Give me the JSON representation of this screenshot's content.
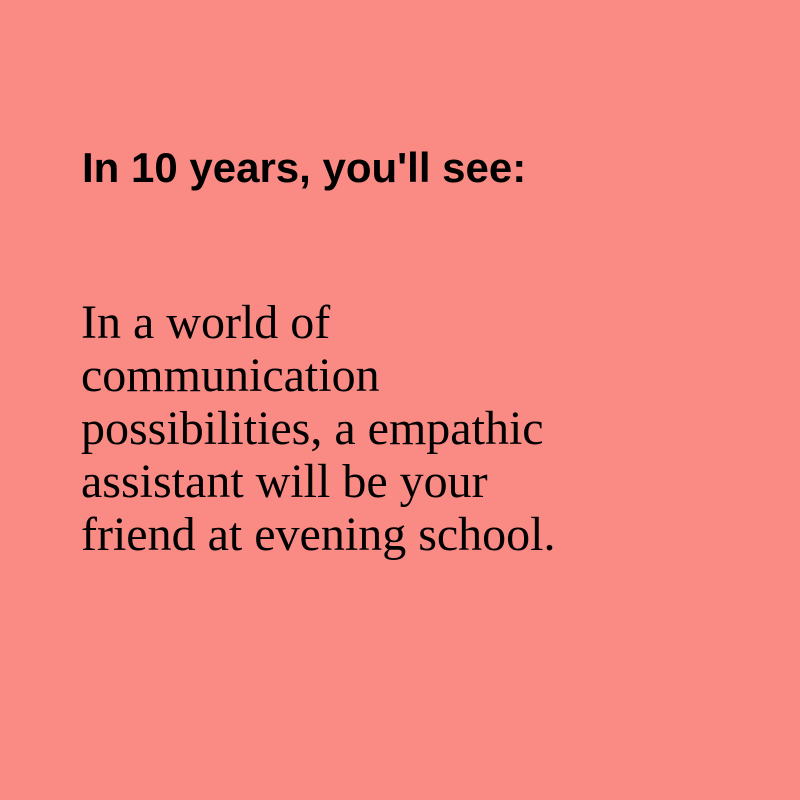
{
  "background_color": "#fa8a84",
  "text_color": "#000000",
  "heading": "In 10 years, you'll see:",
  "body_lines": [
    "In a world of",
    "communication",
    "possibilities, a empathic",
    "assistant will be your",
    "friend at evening school."
  ]
}
